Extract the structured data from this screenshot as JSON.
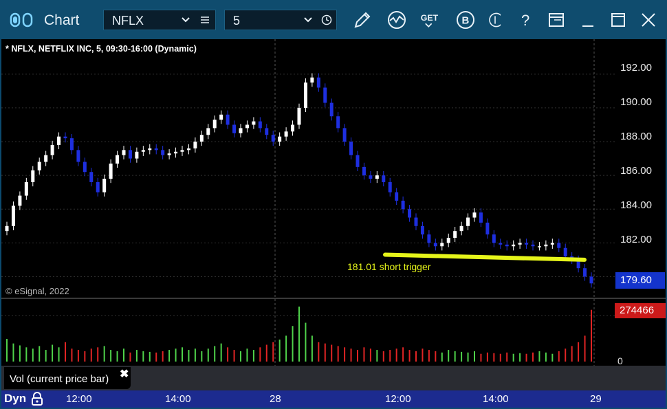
{
  "window": {
    "title": "Chart",
    "symbol": "NFLX",
    "interval": "5"
  },
  "toolbar": {
    "icons": [
      "draw-pencil-icon",
      "study-wave-icon",
      "get-data-icon",
      "b-circle-icon",
      "link-number-icon",
      "help-icon",
      "layout-icon",
      "minimize-icon",
      "maximize-icon",
      "close-icon"
    ],
    "get_label": "GET",
    "b_label": "B",
    "help_label": "?"
  },
  "chart": {
    "title": "* NFLX, NETFLIX INC, 5, 09:30-16:00 (Dynamic)",
    "copyright": "© eSignal, 2022",
    "annotation": "181.01 short trigger",
    "price_labels": [
      "192.00",
      "190.00",
      "188.00",
      "186.00",
      "184.00",
      "182.00"
    ],
    "last_price": "179.60",
    "colors": {
      "up": "#ffffff",
      "down": "#1e2fe0",
      "trigger": "#e6f51a",
      "vol_up": "#4fd24a",
      "vol_down": "#e02424"
    }
  },
  "volume": {
    "label": "Vol (current price bar)",
    "close_symbol": "✖",
    "last_value": "274466",
    "zero_label": "0"
  },
  "time_axis": {
    "mode": "Dyn",
    "labels": [
      "12:00",
      "14:00",
      "28",
      "12:00",
      "14:00",
      "29"
    ]
  },
  "chart_data": {
    "type": "candlestick",
    "title": "* NFLX, NETFLIX INC, 5, 09:30-16:00 (Dynamic)",
    "y_range": [
      179.0,
      193.5
    ],
    "y_ticks": [
      182,
      184,
      186,
      188,
      190,
      192
    ],
    "x_tick_labels": [
      "12:00",
      "14:00",
      "28",
      "12:00",
      "14:00",
      "29"
    ],
    "annotation": {
      "text": "181.01 short trigger",
      "line_start": 181.3,
      "line_end": 181.0
    },
    "last_price": 179.6,
    "closes": [
      183.0,
      184.2,
      184.8,
      185.6,
      186.3,
      186.8,
      187.2,
      187.8,
      188.3,
      188.2,
      187.5,
      186.8,
      186.2,
      185.6,
      185.0,
      185.8,
      186.7,
      187.2,
      187.5,
      187.0,
      187.4,
      187.5,
      187.6,
      187.5,
      187.2,
      187.3,
      187.4,
      187.5,
      187.6,
      188.0,
      188.4,
      188.8,
      189.3,
      189.6,
      189.0,
      188.5,
      188.8,
      189.0,
      189.2,
      188.8,
      188.4,
      188.0,
      188.3,
      188.6,
      189.0,
      190.0,
      191.5,
      191.8,
      191.2,
      190.3,
      189.5,
      188.8,
      188.0,
      187.2,
      186.5,
      186.0,
      185.8,
      186.0,
      185.6,
      185.0,
      184.5,
      184.0,
      183.5,
      183.0,
      182.5,
      182.0,
      181.8,
      182.0,
      182.3,
      182.7,
      183.0,
      183.5,
      183.8,
      183.2,
      182.5,
      182.0,
      181.9,
      181.8,
      181.9,
      182.0,
      181.9,
      181.8,
      181.8,
      181.9,
      182.0,
      181.7,
      181.2,
      181.0,
      180.5,
      180.0,
      179.6
    ],
    "volumes": [
      35,
      28,
      25,
      22,
      20,
      24,
      18,
      26,
      22,
      30,
      20,
      18,
      16,
      20,
      22,
      24,
      18,
      16,
      20,
      14,
      18,
      16,
      15,
      14,
      16,
      18,
      20,
      22,
      18,
      20,
      16,
      20,
      24,
      28,
      22,
      18,
      16,
      20,
      18,
      22,
      26,
      30,
      34,
      40,
      55,
      85,
      60,
      40,
      30,
      28,
      26,
      24,
      22,
      20,
      18,
      22,
      20,
      18,
      16,
      18,
      20,
      22,
      18,
      16,
      20,
      18,
      16,
      14,
      18,
      16,
      15,
      14,
      16,
      12,
      14,
      13,
      12,
      14,
      12,
      13,
      12,
      14,
      16,
      14,
      12,
      16,
      20,
      24,
      30,
      40,
      80
    ]
  }
}
